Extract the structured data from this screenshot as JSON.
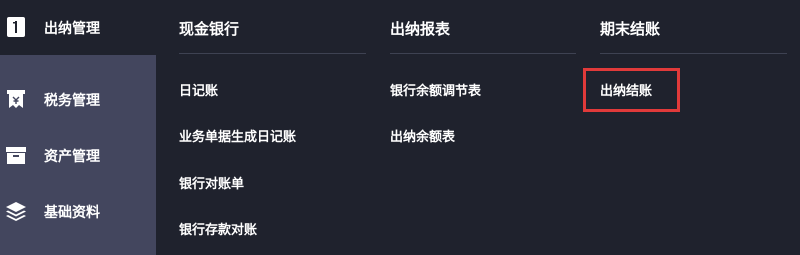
{
  "sidebar": {
    "items": [
      {
        "label": "出纳管理",
        "icon": "cashier-book-icon",
        "active": true
      },
      {
        "label": "税务管理",
        "icon": "tax-receipt-icon"
      },
      {
        "label": "资产管理",
        "icon": "asset-box-icon"
      },
      {
        "label": "基础资料",
        "icon": "layers-icon"
      }
    ]
  },
  "menu": {
    "columns": [
      {
        "title": "现金银行",
        "items": [
          "日记账",
          "业务单据生成日记账",
          "银行对账单",
          "银行存款对账"
        ]
      },
      {
        "title": "出纳报表",
        "items": [
          "银行余额调节表",
          "出纳余额表"
        ]
      },
      {
        "title": "期末结账",
        "items": [
          "出纳结账"
        ]
      }
    ],
    "highlighted_item": "出纳结账"
  },
  "colors": {
    "sidebar_bg": "#43465e",
    "menu_bg": "#1f222d",
    "divider": "#3e4252",
    "highlight_border": "#e03a3a",
    "text": "#ffffff"
  }
}
